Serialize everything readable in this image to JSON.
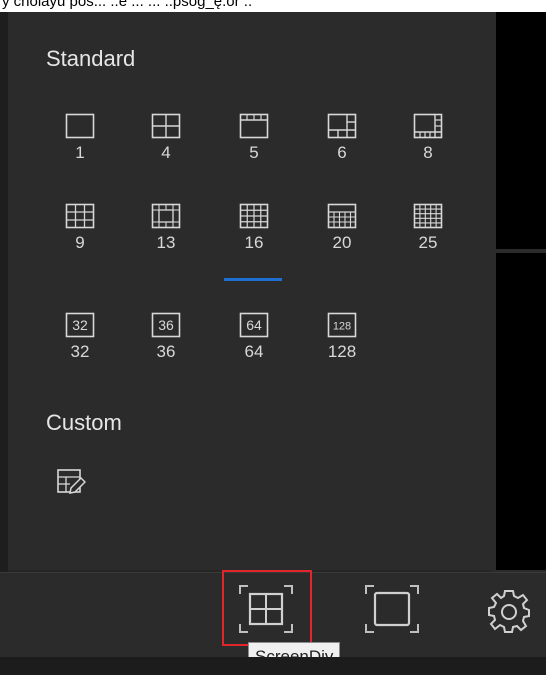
{
  "top_strip_text": "y cholayu pos... ..e ... ... ..psog_ę.or ..",
  "standard": {
    "title": "Standard",
    "options": [
      {
        "label": "1",
        "icon": "layout-1-icon"
      },
      {
        "label": "4",
        "icon": "layout-4-icon"
      },
      {
        "label": "5",
        "icon": "layout-5-icon"
      },
      {
        "label": "6",
        "icon": "layout-6-icon"
      },
      {
        "label": "8",
        "icon": "layout-8-icon"
      },
      {
        "label": "9",
        "icon": "layout-9-icon"
      },
      {
        "label": "13",
        "icon": "layout-13-icon"
      },
      {
        "label": "16",
        "icon": "layout-16-icon",
        "selected": true
      },
      {
        "label": "20",
        "icon": "layout-20-icon"
      },
      {
        "label": "25",
        "icon": "layout-25-icon"
      },
      {
        "label": "32",
        "icon": "layout-32-icon",
        "box_text": "32"
      },
      {
        "label": "36",
        "icon": "layout-36-icon",
        "box_text": "36"
      },
      {
        "label": "64",
        "icon": "layout-64-icon",
        "box_text": "64"
      },
      {
        "label": "128",
        "icon": "layout-128-icon",
        "box_text": "128"
      }
    ]
  },
  "custom": {
    "title": "Custom",
    "edit_icon": "custom-layout-edit-icon"
  },
  "toolbar": {
    "screendiv_icon": "screen-division-icon",
    "fullscreen_icon": "fullscreen-icon",
    "settings_icon": "gear-icon",
    "tooltip": "ScreenDiv"
  },
  "colors": {
    "panel_bg": "#2b2b2b",
    "selected_underline": "#1e6fd0",
    "highlight_border": "#e0262b"
  }
}
